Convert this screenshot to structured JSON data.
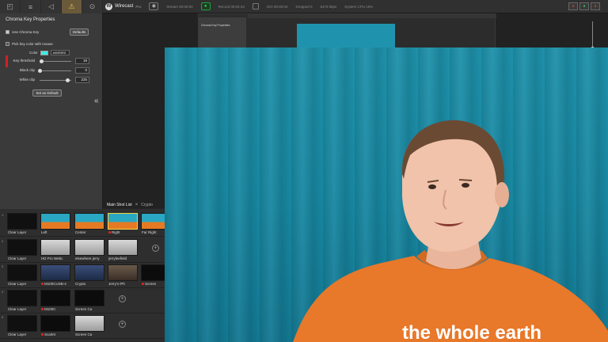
{
  "app": {
    "name": "Wirecast",
    "edition": "Pro",
    "logo_letter": "W"
  },
  "status_bar": {
    "stats": [
      "Stream 00:00:00",
      "Record 00:02:44",
      "ISO 00:00:00",
      "Dropped 0",
      "6478 kbps",
      "System CPU 19%"
    ],
    "right_buttons": [
      "●",
      "●",
      "●"
    ]
  },
  "tool_tabs": [
    "◰",
    "≡",
    "◁",
    "⚠",
    "⊙"
  ],
  "properties": {
    "title": "Chroma Key Properties",
    "use_chroma_key_label": "Use Chroma Key",
    "defaults_button": "Defaults",
    "pick_color_label": "Pick key color with mouse",
    "color_label": "Color",
    "color_hex": "#40E9E0",
    "color_value": "#40e9e0",
    "sliders": [
      {
        "label": "Key threshold",
        "value": "18",
        "level": 0.05
      },
      {
        "label": "Black clip",
        "value": "0",
        "level": 0.0
      },
      {
        "label": "White clip",
        "value": "225",
        "level": 0.88
      }
    ],
    "set_default_button": "Set as Default",
    "collapse_glyph": "«"
  },
  "shot_list": {
    "tabs": [
      "Main Shot List",
      "×",
      "Crypto"
    ],
    "rows": [
      {
        "num": "1",
        "shots": [
          {
            "label": "Clear Layer",
            "thumb": "layer",
            "live": false,
            "dot": false
          },
          {
            "label": "Left",
            "thumb": "orange",
            "live": false,
            "dot": false
          },
          {
            "label": "Center",
            "thumb": "orange",
            "live": false,
            "dot": false
          },
          {
            "label": "Right",
            "thumb": "orange",
            "live": true,
            "dot": true
          },
          {
            "label": "Far Right",
            "thumb": "orange",
            "live": false,
            "dot": false
          }
        ]
      },
      {
        "num": "2",
        "shots": [
          {
            "label": "Clear Layer",
            "thumb": "layer",
            "live": false,
            "dot": false
          },
          {
            "label": "HD Pro Webc",
            "thumb": "desk",
            "live": false,
            "dot": false
          },
          {
            "label": "elsewhere jerry",
            "thumb": "desk",
            "live": false,
            "dot": false
          },
          {
            "label": "jerryleefield",
            "thumb": "desk",
            "live": false,
            "dot": false
          }
        ]
      },
      {
        "num": "3",
        "shots": [
          {
            "label": "Clear Layer",
            "thumb": "layer",
            "live": false,
            "dot": false
          },
          {
            "label": "M100CUSB-4",
            "thumb": "screen",
            "live": false,
            "dot": true
          },
          {
            "label": "Crypto",
            "thumb": "screen",
            "live": false,
            "dot": false
          },
          {
            "label": "Jerry's iPh",
            "thumb": "brown",
            "live": false,
            "dot": false
          },
          {
            "label": "Screen",
            "thumb": "dark",
            "live": false,
            "dot": true
          }
        ]
      },
      {
        "num": "4",
        "shots": [
          {
            "label": "Clear Layer",
            "thumb": "layer",
            "live": false,
            "dot": false
          },
          {
            "label": "M100C",
            "thumb": "dark",
            "live": false,
            "dot": true
          },
          {
            "label": "Screen Ca",
            "thumb": "dark",
            "live": false,
            "dot": false
          }
        ]
      },
      {
        "num": "5",
        "shots": [
          {
            "label": "Clear Layer",
            "thumb": "layer",
            "live": false,
            "dot": false
          },
          {
            "label": "Scarlet",
            "thumb": "dark",
            "live": false,
            "dot": true
          },
          {
            "label": "Screen Ca",
            "thumb": "desk",
            "live": false,
            "dot": false
          }
        ]
      }
    ],
    "add_glyph": "+"
  },
  "program": {
    "shirt_text": "the whole earth"
  },
  "nested_preview": {
    "title": "Chroma Key Properties"
  }
}
